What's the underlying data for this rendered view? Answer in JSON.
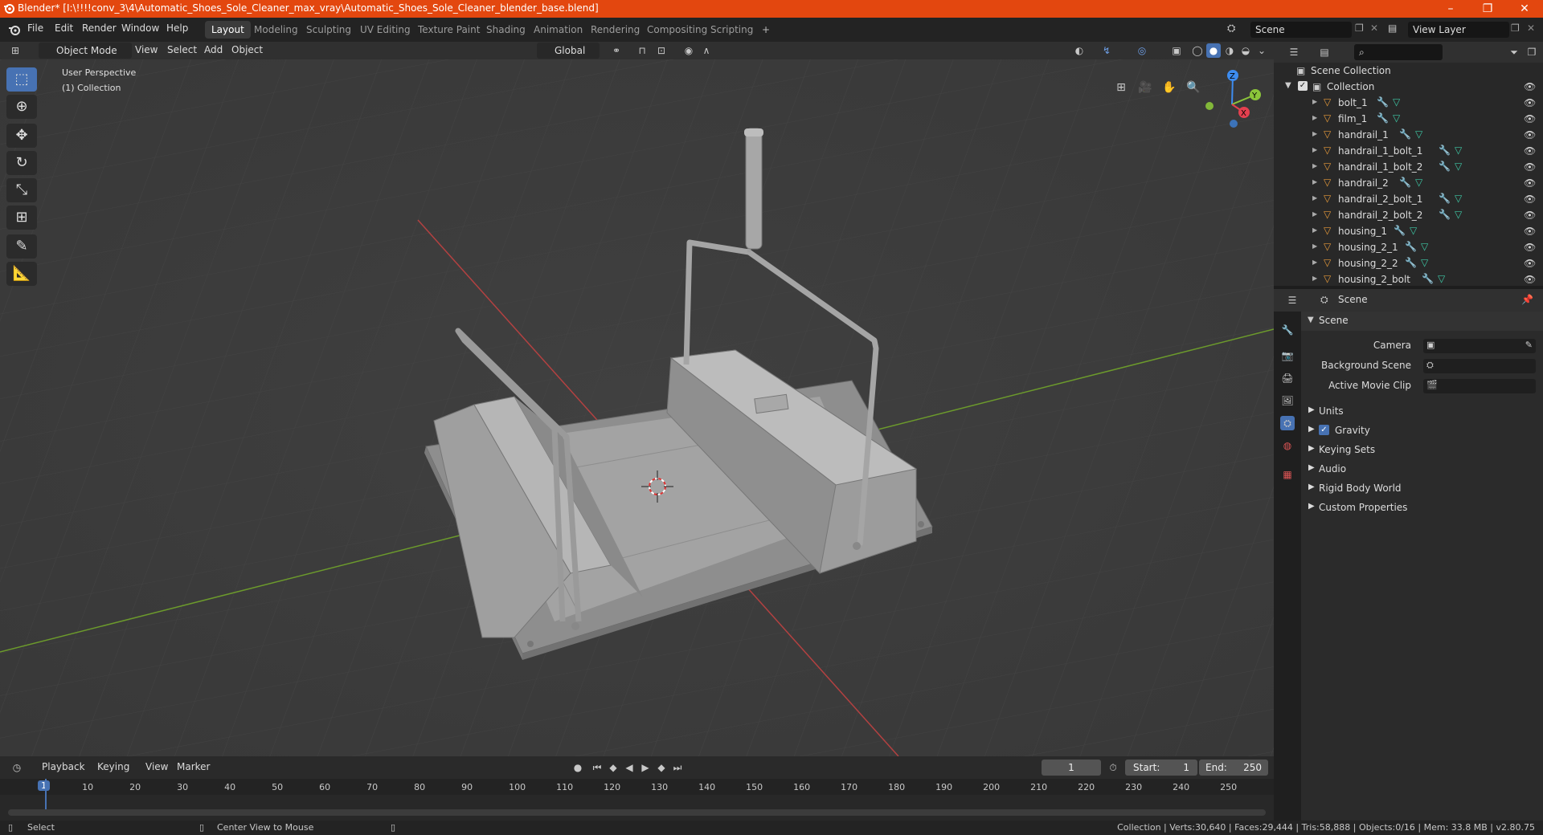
{
  "window": {
    "title": "Blender* [I:\\!!!!conv_3\\4\\Automatic_Shoes_Sole_Cleaner_max_vray\\Automatic_Shoes_Sole_Cleaner_blender_base.blend]",
    "buttons": [
      "–",
      "❐",
      "✕"
    ]
  },
  "menu": [
    "File",
    "Edit",
    "Render",
    "Window",
    "Help"
  ],
  "workspaces": [
    "Layout",
    "Modeling",
    "Sculpting",
    "UV Editing",
    "Texture Paint",
    "Shading",
    "Animation",
    "Rendering",
    "Compositing",
    "Scripting"
  ],
  "workspace_add": "+",
  "scene_field": "Scene",
  "view_layer_field": "View Layer",
  "viewport_header": {
    "mode": "Object Mode",
    "menus": [
      "View",
      "Select",
      "Add",
      "Object"
    ],
    "orientation": "Global"
  },
  "viewport": {
    "perspective": "User Perspective",
    "collection": "(1) Collection",
    "gizmo": {
      "z": "Z",
      "y": "Y",
      "x": "X"
    }
  },
  "timeline": {
    "menus": [
      "Playback",
      "Keying",
      "View",
      "Marker"
    ],
    "current_frame": "1",
    "start_label": "Start:",
    "start": "1",
    "end_label": "End:",
    "end": "250",
    "ruler": [
      "1",
      "10",
      "20",
      "30",
      "40",
      "50",
      "60",
      "70",
      "80",
      "90",
      "100",
      "110",
      "120",
      "130",
      "140",
      "150",
      "160",
      "170",
      "180",
      "190",
      "200",
      "210",
      "220",
      "230",
      "240",
      "250"
    ]
  },
  "statusbar": {
    "left": "Select",
    "middle": "Center View to Mouse",
    "right": "Collection | Verts:30,640 | Faces:29,444 | Tris:58,888 | Objects:0/16 | Mem: 33.8 MB | v2.80.75"
  },
  "outliner": {
    "scene_collection": "Scene Collection",
    "collection": "Collection",
    "objects": [
      "bolt_1",
      "film_1",
      "handrail_1",
      "handrail_1_bolt_1",
      "handrail_1_bolt_2",
      "handrail_2",
      "handrail_2_bolt_1",
      "handrail_2_bolt_2",
      "housing_1",
      "housing_2_1",
      "housing_2_2",
      "housing_2_bolt"
    ]
  },
  "properties": {
    "header": "Scene",
    "panel_title": "Scene",
    "camera_label": "Camera",
    "background_scene_label": "Background Scene",
    "active_movie_clip_label": "Active Movie Clip",
    "sections": [
      "Units",
      "Gravity",
      "Keying Sets",
      "Audio",
      "Rigid Body World",
      "Custom Properties"
    ],
    "gravity_checked": true
  },
  "colors": {
    "titlebar": "#e3470f",
    "accent": "#4772b3",
    "x_axis": "#b34141",
    "y_axis": "#6c9a2c",
    "gizmo_x": "#e4404f",
    "gizmo_y": "#8bc53a",
    "gizmo_z": "#3d8cf0"
  }
}
